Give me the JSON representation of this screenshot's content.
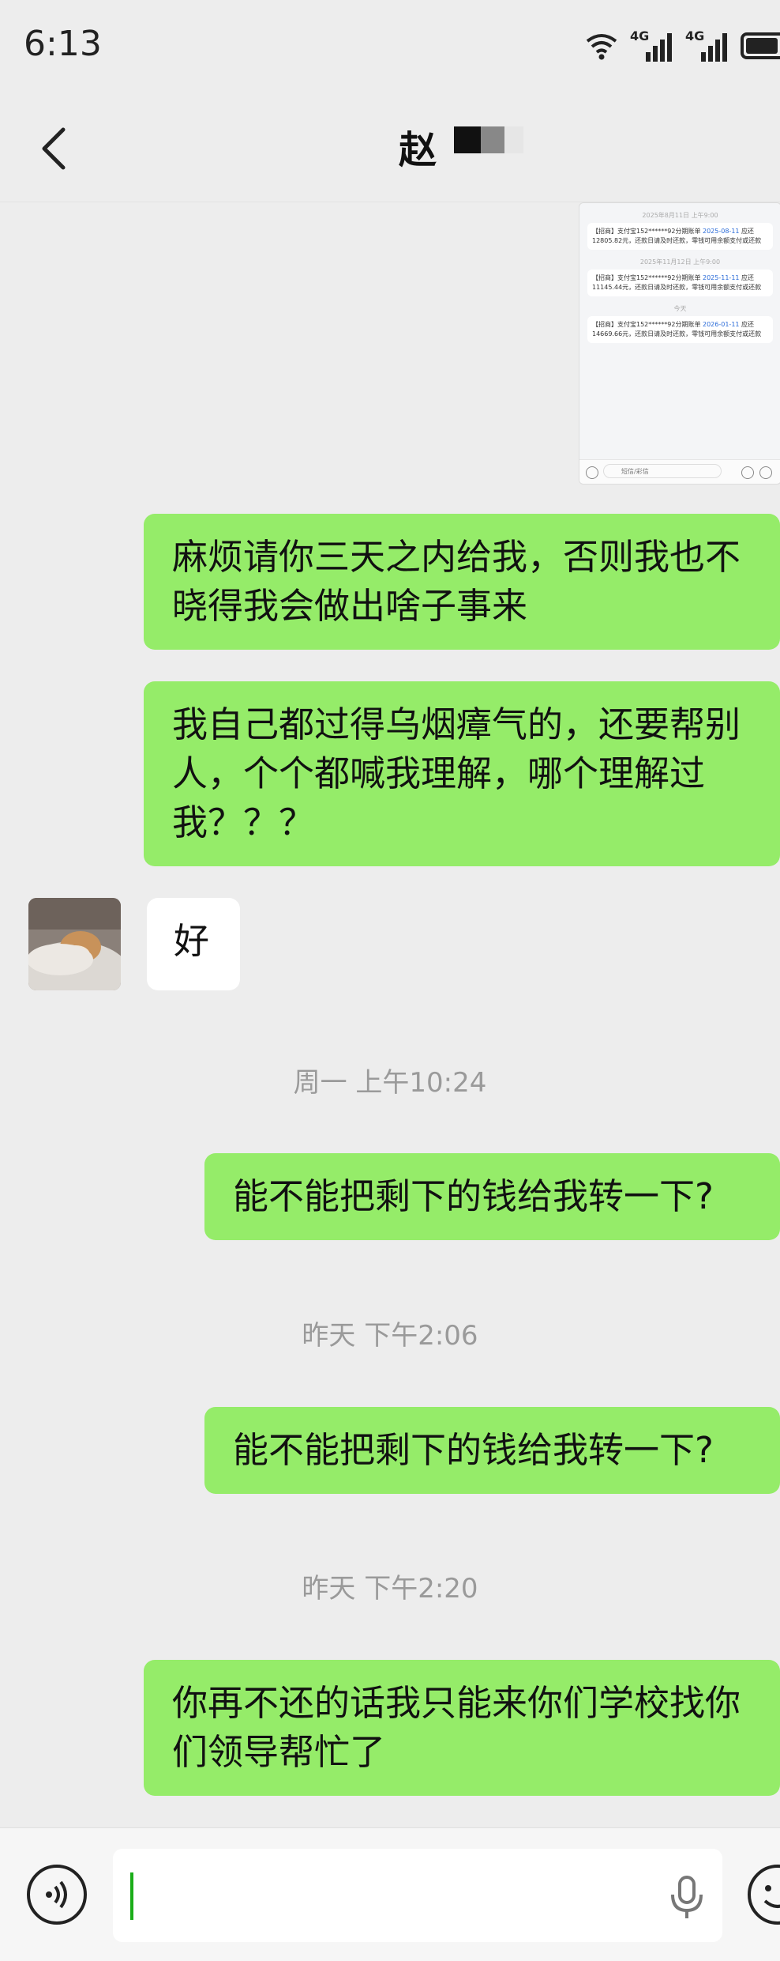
{
  "status_bar": {
    "time": "6:13",
    "net1": "4G",
    "net2": "4G"
  },
  "header": {
    "contact_name": "赵"
  },
  "screenshot_preview": {
    "timestamps": [
      "2025年8月11日 上午9:00",
      "2025年11月12日 上午9:00",
      "今天"
    ],
    "cards": [
      {
        "prefix": "【招商】支付宝152******92分期账单",
        "date": "2025-08-11",
        "rest": "应还12805.82元，还款日请及时还款，零钱可用余额支付或还款"
      },
      {
        "prefix": "【招商】支付宝152******92分期账单",
        "date": "2025-11-11",
        "rest": "应还11145.44元，还款日请及时还款，零钱可用余额支付或还款"
      },
      {
        "prefix": "【招商】支付宝152******92分期账单",
        "date": "2026-01-11",
        "rest": "应还14669.66元，还款日请及时还款，零钱可用余额支付或还款"
      }
    ],
    "input_placeholder": "短信/彩信"
  },
  "messages": [
    {
      "kind": "out",
      "text": "麻烦请你三天之内给我，否则我也不晓得我会做出啥子事来"
    },
    {
      "kind": "out",
      "text": "我自己都过得乌烟瘴气的，还要帮别人，个个都喊我理解，哪个理解过我？？？"
    },
    {
      "kind": "in",
      "text": "好"
    },
    {
      "kind": "time",
      "text": "周一 上午10:24"
    },
    {
      "kind": "out",
      "text": "能不能把剩下的钱给我转一下?"
    },
    {
      "kind": "time",
      "text": "昨天 下午2:06"
    },
    {
      "kind": "out",
      "text": "能不能把剩下的钱给我转一下?"
    },
    {
      "kind": "time",
      "text": "昨天 下午2:20"
    },
    {
      "kind": "out",
      "text": "你再不还的话我只能来你们学校找你们领导帮忙了"
    }
  ],
  "composer": {
    "value": ""
  },
  "colors": {
    "bubble_out": "#95ec69",
    "bubble_in": "#ffffff",
    "background": "#ededed",
    "caret": "#1aad19"
  },
  "icons": [
    "back-arrow-icon",
    "wifi-icon",
    "signal-icon",
    "battery-icon",
    "voice-toggle-icon",
    "microphone-icon",
    "emoji-icon"
  ]
}
